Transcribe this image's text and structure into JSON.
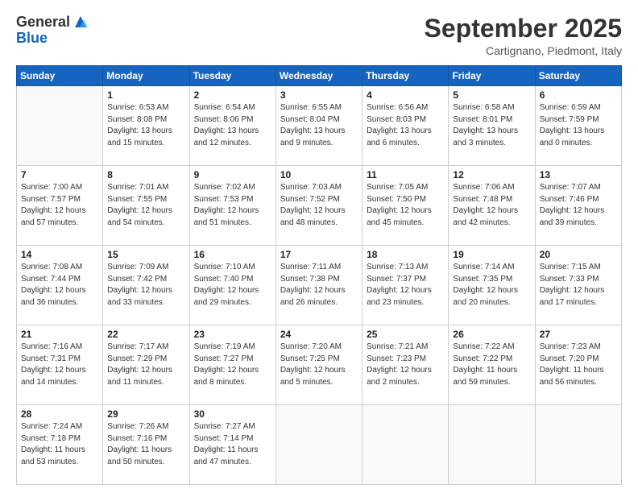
{
  "logo": {
    "general": "General",
    "blue": "Blue"
  },
  "header": {
    "month": "September 2025",
    "location": "Cartignano, Piedmont, Italy"
  },
  "days_of_week": [
    "Sunday",
    "Monday",
    "Tuesday",
    "Wednesday",
    "Thursday",
    "Friday",
    "Saturday"
  ],
  "weeks": [
    [
      {
        "day": "",
        "info": ""
      },
      {
        "day": "1",
        "info": "Sunrise: 6:53 AM\nSunset: 8:08 PM\nDaylight: 13 hours\nand 15 minutes."
      },
      {
        "day": "2",
        "info": "Sunrise: 6:54 AM\nSunset: 8:06 PM\nDaylight: 13 hours\nand 12 minutes."
      },
      {
        "day": "3",
        "info": "Sunrise: 6:55 AM\nSunset: 8:04 PM\nDaylight: 13 hours\nand 9 minutes."
      },
      {
        "day": "4",
        "info": "Sunrise: 6:56 AM\nSunset: 8:03 PM\nDaylight: 13 hours\nand 6 minutes."
      },
      {
        "day": "5",
        "info": "Sunrise: 6:58 AM\nSunset: 8:01 PM\nDaylight: 13 hours\nand 3 minutes."
      },
      {
        "day": "6",
        "info": "Sunrise: 6:59 AM\nSunset: 7:59 PM\nDaylight: 13 hours\nand 0 minutes."
      }
    ],
    [
      {
        "day": "7",
        "info": "Sunrise: 7:00 AM\nSunset: 7:57 PM\nDaylight: 12 hours\nand 57 minutes."
      },
      {
        "day": "8",
        "info": "Sunrise: 7:01 AM\nSunset: 7:55 PM\nDaylight: 12 hours\nand 54 minutes."
      },
      {
        "day": "9",
        "info": "Sunrise: 7:02 AM\nSunset: 7:53 PM\nDaylight: 12 hours\nand 51 minutes."
      },
      {
        "day": "10",
        "info": "Sunrise: 7:03 AM\nSunset: 7:52 PM\nDaylight: 12 hours\nand 48 minutes."
      },
      {
        "day": "11",
        "info": "Sunrise: 7:05 AM\nSunset: 7:50 PM\nDaylight: 12 hours\nand 45 minutes."
      },
      {
        "day": "12",
        "info": "Sunrise: 7:06 AM\nSunset: 7:48 PM\nDaylight: 12 hours\nand 42 minutes."
      },
      {
        "day": "13",
        "info": "Sunrise: 7:07 AM\nSunset: 7:46 PM\nDaylight: 12 hours\nand 39 minutes."
      }
    ],
    [
      {
        "day": "14",
        "info": "Sunrise: 7:08 AM\nSunset: 7:44 PM\nDaylight: 12 hours\nand 36 minutes."
      },
      {
        "day": "15",
        "info": "Sunrise: 7:09 AM\nSunset: 7:42 PM\nDaylight: 12 hours\nand 33 minutes."
      },
      {
        "day": "16",
        "info": "Sunrise: 7:10 AM\nSunset: 7:40 PM\nDaylight: 12 hours\nand 29 minutes."
      },
      {
        "day": "17",
        "info": "Sunrise: 7:11 AM\nSunset: 7:38 PM\nDaylight: 12 hours\nand 26 minutes."
      },
      {
        "day": "18",
        "info": "Sunrise: 7:13 AM\nSunset: 7:37 PM\nDaylight: 12 hours\nand 23 minutes."
      },
      {
        "day": "19",
        "info": "Sunrise: 7:14 AM\nSunset: 7:35 PM\nDaylight: 12 hours\nand 20 minutes."
      },
      {
        "day": "20",
        "info": "Sunrise: 7:15 AM\nSunset: 7:33 PM\nDaylight: 12 hours\nand 17 minutes."
      }
    ],
    [
      {
        "day": "21",
        "info": "Sunrise: 7:16 AM\nSunset: 7:31 PM\nDaylight: 12 hours\nand 14 minutes."
      },
      {
        "day": "22",
        "info": "Sunrise: 7:17 AM\nSunset: 7:29 PM\nDaylight: 12 hours\nand 11 minutes."
      },
      {
        "day": "23",
        "info": "Sunrise: 7:19 AM\nSunset: 7:27 PM\nDaylight: 12 hours\nand 8 minutes."
      },
      {
        "day": "24",
        "info": "Sunrise: 7:20 AM\nSunset: 7:25 PM\nDaylight: 12 hours\nand 5 minutes."
      },
      {
        "day": "25",
        "info": "Sunrise: 7:21 AM\nSunset: 7:23 PM\nDaylight: 12 hours\nand 2 minutes."
      },
      {
        "day": "26",
        "info": "Sunrise: 7:22 AM\nSunset: 7:22 PM\nDaylight: 11 hours\nand 59 minutes."
      },
      {
        "day": "27",
        "info": "Sunrise: 7:23 AM\nSunset: 7:20 PM\nDaylight: 11 hours\nand 56 minutes."
      }
    ],
    [
      {
        "day": "28",
        "info": "Sunrise: 7:24 AM\nSunset: 7:18 PM\nDaylight: 11 hours\nand 53 minutes."
      },
      {
        "day": "29",
        "info": "Sunrise: 7:26 AM\nSunset: 7:16 PM\nDaylight: 11 hours\nand 50 minutes."
      },
      {
        "day": "30",
        "info": "Sunrise: 7:27 AM\nSunset: 7:14 PM\nDaylight: 11 hours\nand 47 minutes."
      },
      {
        "day": "",
        "info": ""
      },
      {
        "day": "",
        "info": ""
      },
      {
        "day": "",
        "info": ""
      },
      {
        "day": "",
        "info": ""
      }
    ]
  ]
}
